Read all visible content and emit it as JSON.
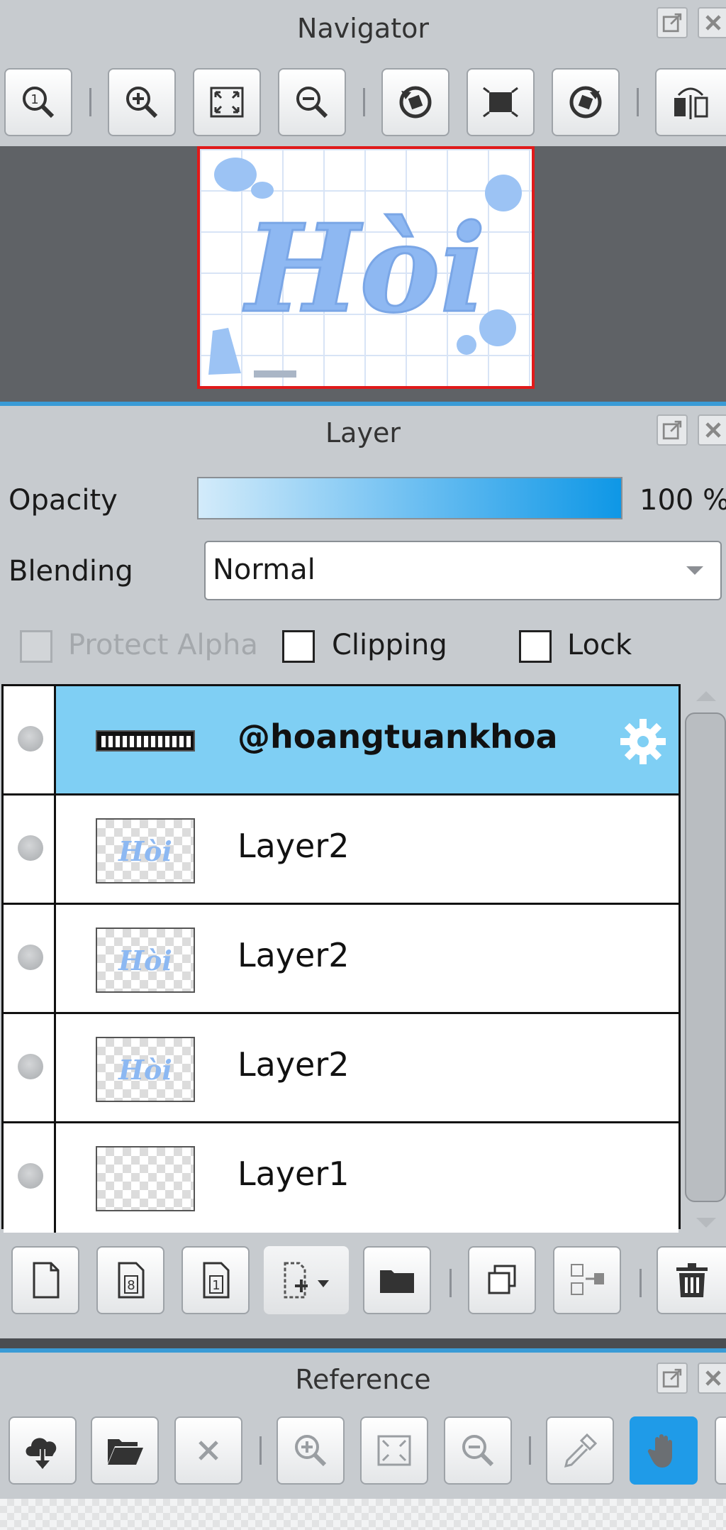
{
  "navigator": {
    "title": "Navigator",
    "canvas_text": "Hòi"
  },
  "layer_panel": {
    "title": "Layer",
    "opacity_label": "Opacity",
    "opacity_value": "100 %",
    "opacity_level": 1.0,
    "blending_label": "Blending",
    "blending_value": "Normal",
    "protect_alpha_label": "Protect Alpha",
    "clipping_label": "Clipping",
    "lock_label": "Lock",
    "layers": [
      {
        "name": "@hoangtuankhoa",
        "selected": true,
        "thumb": "banner"
      },
      {
        "name": "Layer2",
        "selected": false,
        "thumb": "Hòi"
      },
      {
        "name": "Layer2",
        "selected": false,
        "thumb": "Hòi"
      },
      {
        "name": "Layer2",
        "selected": false,
        "thumb": "Hòi"
      },
      {
        "name": "Layer1",
        "selected": false,
        "thumb": "empty"
      }
    ]
  },
  "reference": {
    "title": "Reference"
  },
  "colors": {
    "panel_bg": "#c7cbcf",
    "selected_row": "#7fcff4",
    "accent_blue": "#1f9be8",
    "navigator_frame": "#e01a1a"
  },
  "icons": {
    "navigator_toolbar": [
      "zoom-actual-icon",
      "zoom-in-icon",
      "fit-screen-icon",
      "zoom-out-icon",
      "rotate-left-icon",
      "fit-view-icon",
      "rotate-right-icon",
      "flip-horizontal-icon"
    ],
    "layer_toolbar": [
      "new-layer-icon",
      "new-8bit-layer-icon",
      "new-1bit-layer-icon",
      "add-layer-dropdown-icon",
      "new-folder-icon",
      "duplicate-layer-icon",
      "merge-layer-icon",
      "delete-layer-icon"
    ],
    "reference_toolbar": [
      "import-cloud-icon",
      "open-folder-icon",
      "close-icon",
      "zoom-in-icon",
      "fit-screen-icon",
      "zoom-out-icon",
      "eyedropper-icon",
      "hand-icon"
    ]
  }
}
